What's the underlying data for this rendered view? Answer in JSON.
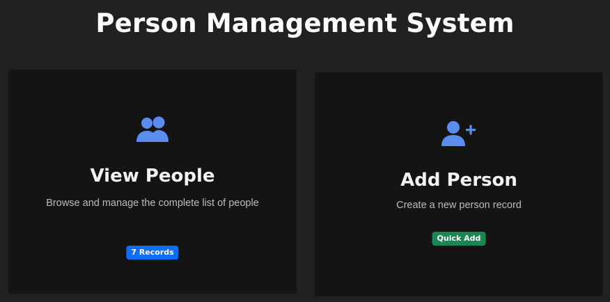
{
  "header": {
    "title": "Person Management System"
  },
  "cards": {
    "view": {
      "icon": "users-icon",
      "title": "View People",
      "description": "Browse and manage the complete list of people",
      "badge": "7 Records"
    },
    "add": {
      "icon": "user-plus-icon",
      "title": "Add Person",
      "description": "Create a new person record",
      "badge": "Quick Add"
    }
  },
  "colors": {
    "background": "#202123",
    "card": "#141414",
    "icon_accent": "#5b8def",
    "badge_primary": "#0d6efd",
    "badge_success": "#198754"
  }
}
